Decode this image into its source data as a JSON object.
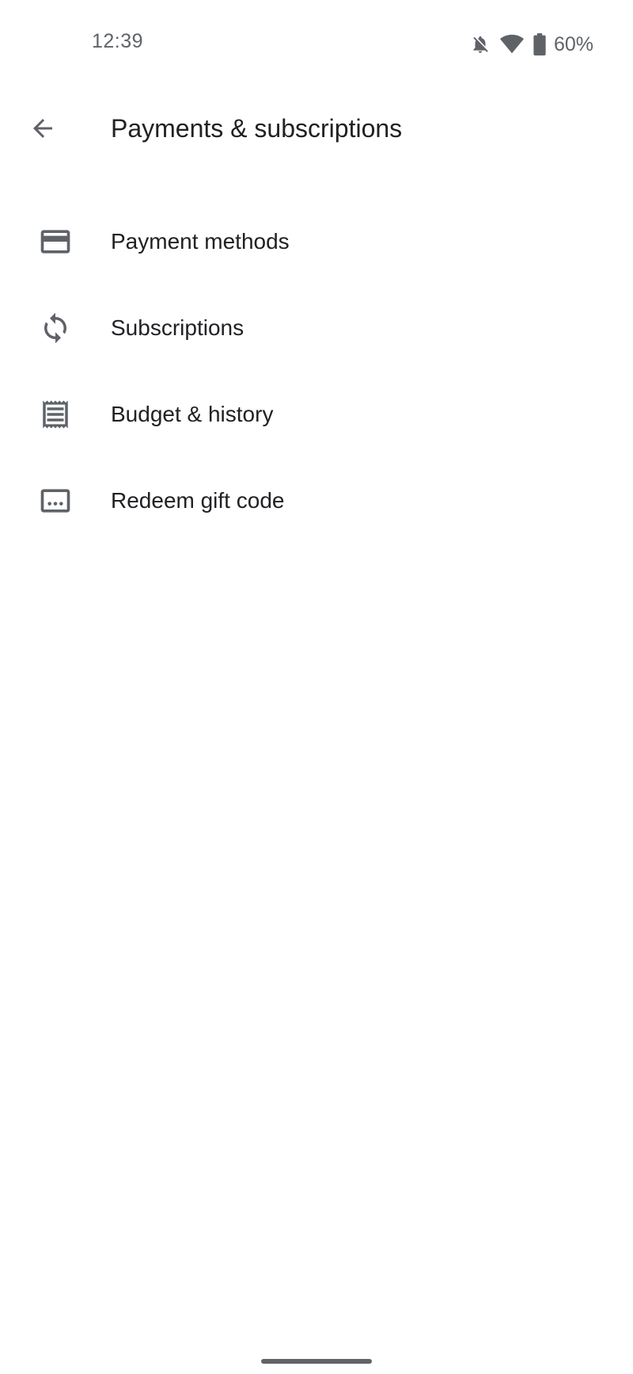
{
  "status_bar": {
    "time": "12:39",
    "battery_percent": "60%",
    "icons": [
      "notifications-off-icon",
      "wifi-icon",
      "battery-icon"
    ]
  },
  "app_bar": {
    "back_icon": "arrow-back-icon",
    "title": "Payments & subscriptions"
  },
  "menu": {
    "items": [
      {
        "label": "Payment methods",
        "icon": "credit-card-icon"
      },
      {
        "label": "Subscriptions",
        "icon": "sync-icon"
      },
      {
        "label": "Budget & history",
        "icon": "receipt-icon"
      },
      {
        "label": "Redeem gift code",
        "icon": "gift-code-icon"
      }
    ]
  },
  "colors": {
    "icon": "#5f6368",
    "text_primary": "#202124",
    "background": "#ffffff"
  }
}
